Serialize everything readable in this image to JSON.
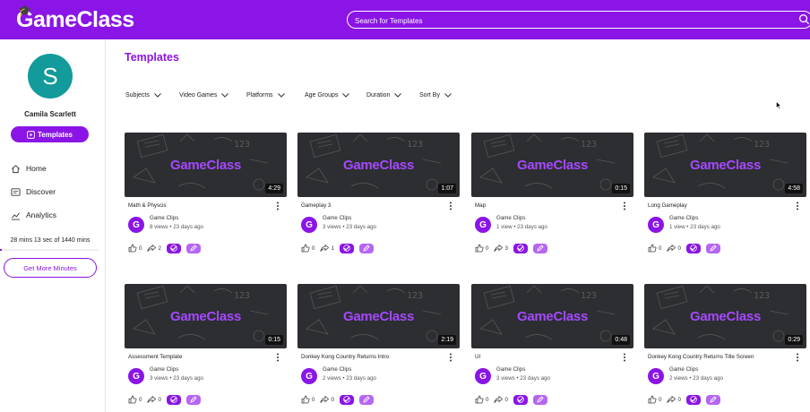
{
  "app": {
    "logo_text": "GameClass",
    "search_placeholder": "Search for Templates"
  },
  "sidebar": {
    "avatar_letter": "S",
    "user_name": "Camila Scarlett",
    "templates_label": "Templates",
    "nav": [
      {
        "label": "Home",
        "icon": "home-icon"
      },
      {
        "label": "Discover",
        "icon": "discover-icon"
      },
      {
        "label": "Analytics",
        "icon": "analytics-icon"
      }
    ],
    "minutes_text": "28 mins 13 sec of 1440 mins",
    "minutes_progress": 0.02,
    "more_minutes_label": "Get More Minutes"
  },
  "main": {
    "title": "Templates",
    "filters": [
      "Subjects",
      "Video Games",
      "Platforms",
      "Age Groups",
      "Duration",
      "Sort By"
    ]
  },
  "cards": [
    {
      "title": "Math & Physcis",
      "duration": "4:29",
      "channel": "Game Clips",
      "meta": "8 views • 23 days ago",
      "likes": "0",
      "shares": "2"
    },
    {
      "title": "Gameplay 3",
      "duration": "1:07",
      "channel": "Game Clips",
      "meta": "3 views • 23 days ago",
      "likes": "0",
      "shares": "1"
    },
    {
      "title": "Map",
      "duration": "0:15",
      "channel": "Game Clips",
      "meta": "1 view • 23 days ago",
      "likes": "0",
      "shares": "3"
    },
    {
      "title": "Long Gameplay",
      "duration": "4:58",
      "channel": "Game Clips",
      "meta": "1 view • 23 days ago",
      "likes": "0",
      "shares": "0"
    },
    {
      "title": "Assessment Template",
      "duration": "0:15",
      "channel": "Game Clips",
      "meta": "3 views • 23 days ago",
      "likes": "0",
      "shares": "0"
    },
    {
      "title": "Donkey Kong Country Returns Intro",
      "duration": "2:19",
      "channel": "Game Clips",
      "meta": "2 views • 23 days ago",
      "likes": "0",
      "shares": "0"
    },
    {
      "title": "UI",
      "duration": "0:48",
      "channel": "Game Clips",
      "meta": "3 views • 23 days ago",
      "likes": "0",
      "shares": "0"
    },
    {
      "title": "Donkey Kong Country Returns Title Screen",
      "duration": "0:29",
      "channel": "Game Clips",
      "meta": "2 views • 23 days ago",
      "likes": "0",
      "shares": "0"
    }
  ],
  "thumbnail_brand": "GameClass",
  "channel_initial": "G",
  "colors": {
    "brand": "#8a15e6",
    "brand_light": "#b566f2",
    "thumb_bg": "#2c2e31",
    "avatar": "#139a9a"
  }
}
